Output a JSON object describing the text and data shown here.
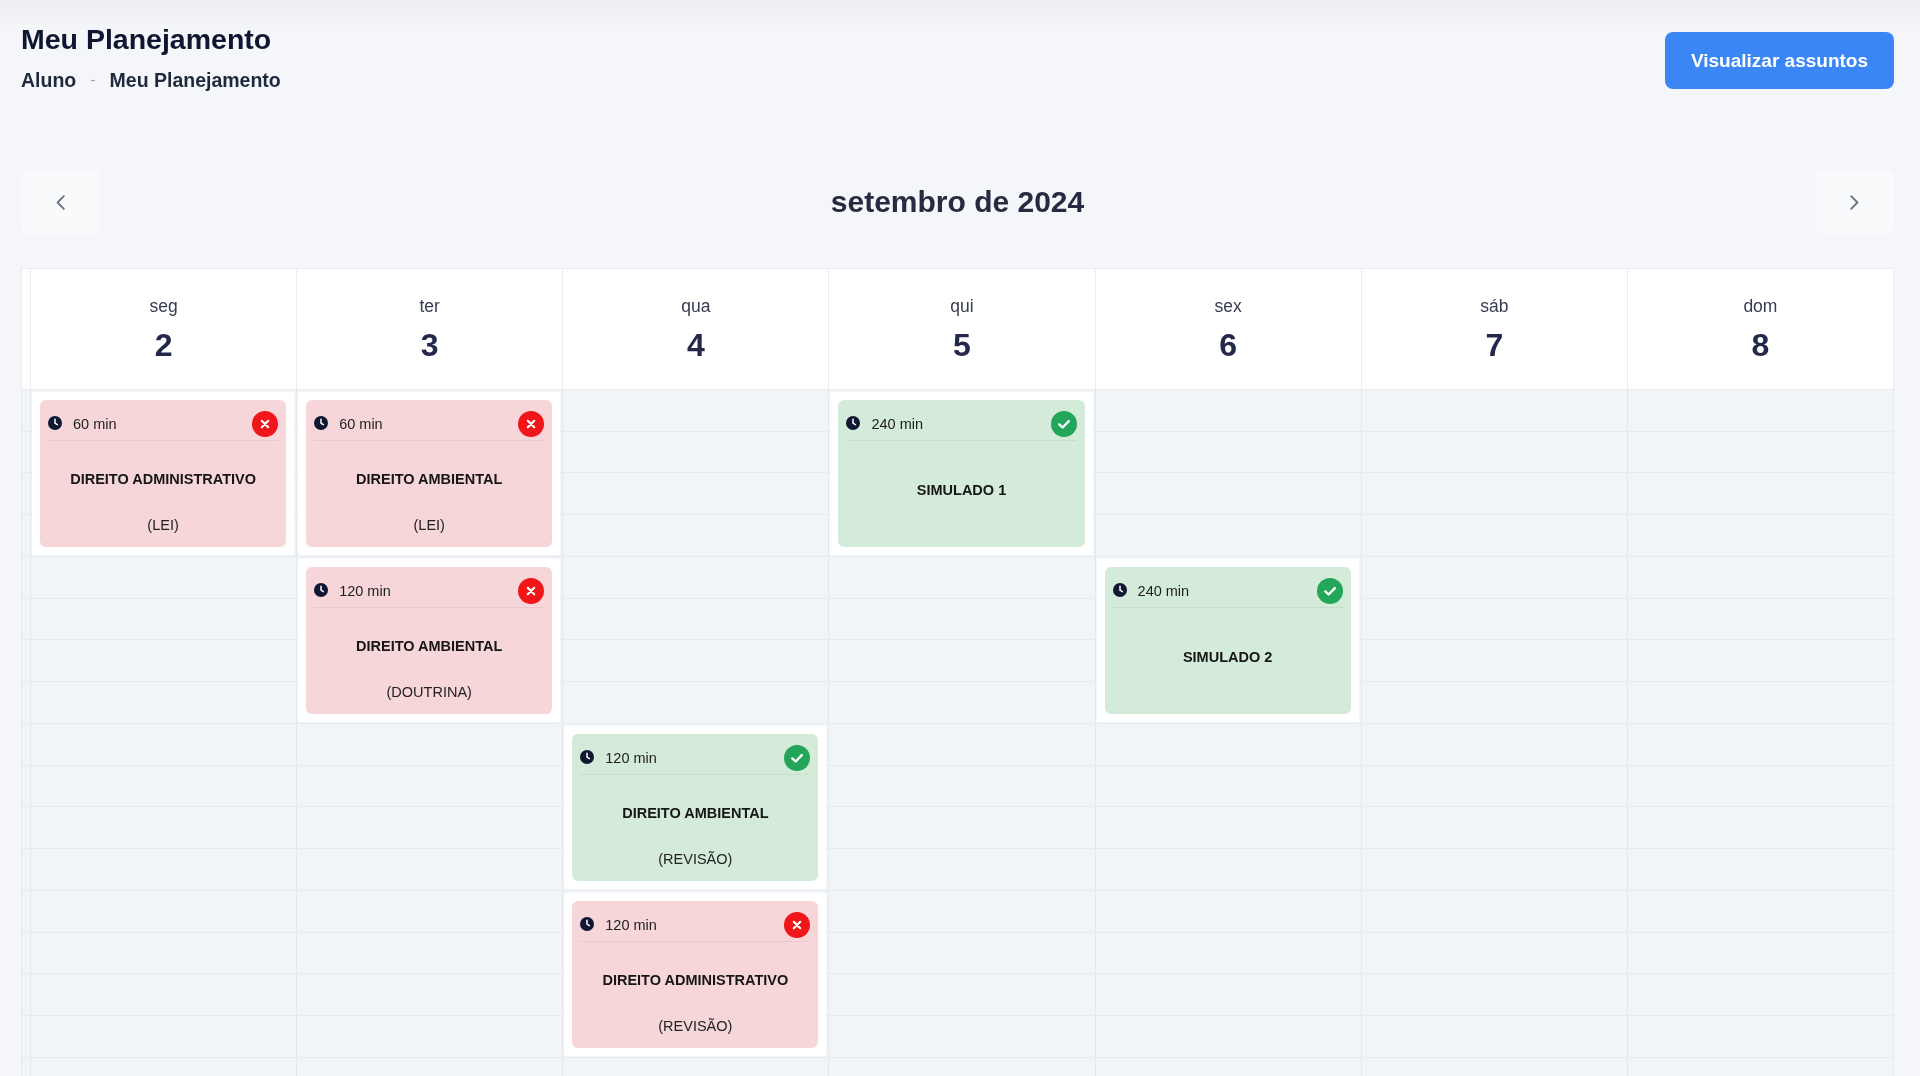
{
  "page": {
    "title": "Meu Planejamento",
    "breadcrumb": {
      "items": [
        "Aluno",
        "Meu Planejamento"
      ],
      "separator": "-"
    },
    "action_button": "Visualizar assuntos"
  },
  "calendar": {
    "month_title": "setembro de 2024",
    "days": [
      {
        "weekday": "seg",
        "date": "2",
        "slots": [
          {
            "kind": "session",
            "duration": "60 min",
            "subject": "DIREITO ADMINISTRATIVO",
            "category": "(LEI)",
            "completed": false
          }
        ]
      },
      {
        "weekday": "ter",
        "date": "3",
        "slots": [
          {
            "kind": "session",
            "duration": "60 min",
            "subject": "DIREITO AMBIENTAL",
            "category": "(LEI)",
            "completed": false
          },
          {
            "kind": "session",
            "duration": "120 min",
            "subject": "DIREITO AMBIENTAL",
            "category": "(DOUTRINA)",
            "completed": false
          }
        ]
      },
      {
        "weekday": "qua",
        "date": "4",
        "slots": [
          {
            "kind": "free"
          },
          {
            "kind": "free"
          },
          {
            "kind": "session",
            "duration": "120 min",
            "subject": "DIREITO AMBIENTAL",
            "category": "(REVISÃO)",
            "completed": true
          },
          {
            "kind": "session",
            "duration": "120 min",
            "subject": "DIREITO ADMINISTRATIVO",
            "category": "(REVISÃO)",
            "completed": false
          }
        ]
      },
      {
        "weekday": "qui",
        "date": "5",
        "slots": [
          {
            "kind": "session",
            "duration": "240 min",
            "subject": "SIMULADO 1",
            "completed": true
          }
        ]
      },
      {
        "weekday": "sex",
        "date": "6",
        "slots": [
          {
            "kind": "free"
          },
          {
            "kind": "session",
            "duration": "240 min",
            "subject": "SIMULADO 2",
            "completed": true
          }
        ]
      },
      {
        "weekday": "sáb",
        "date": "7"
      },
      {
        "weekday": "dom",
        "date": "8"
      }
    ]
  }
}
